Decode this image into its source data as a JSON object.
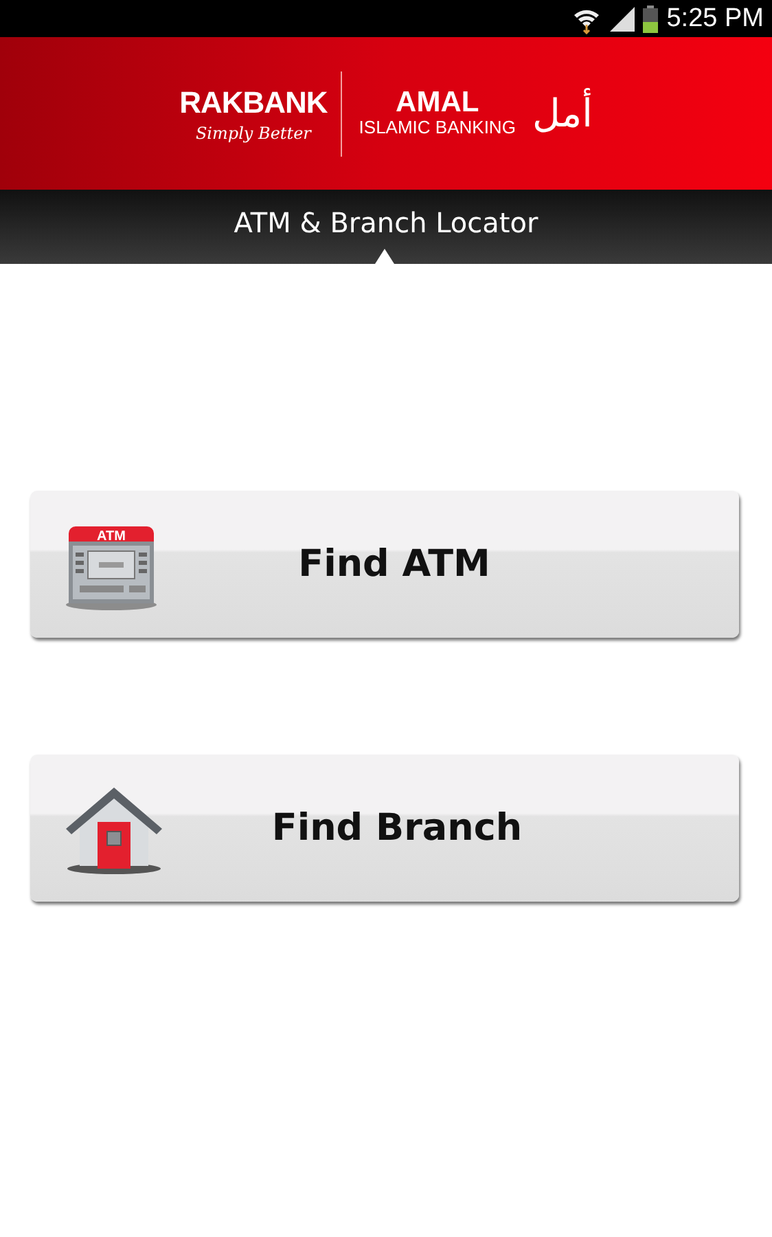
{
  "status_bar": {
    "time": "5:25 PM"
  },
  "header": {
    "brand": "RAKBANK",
    "tagline": "Simply Better",
    "partner": "AMAL",
    "partner_subtitle": "ISLAMIC BANKING",
    "arabic_mark": "أمل"
  },
  "title_bar": {
    "title": "ATM & Branch Locator"
  },
  "buttons": [
    {
      "kind": "atm",
      "label": "Find ATM",
      "icon_label": "ATM"
    },
    {
      "kind": "branch",
      "label": "Find Branch"
    }
  ]
}
